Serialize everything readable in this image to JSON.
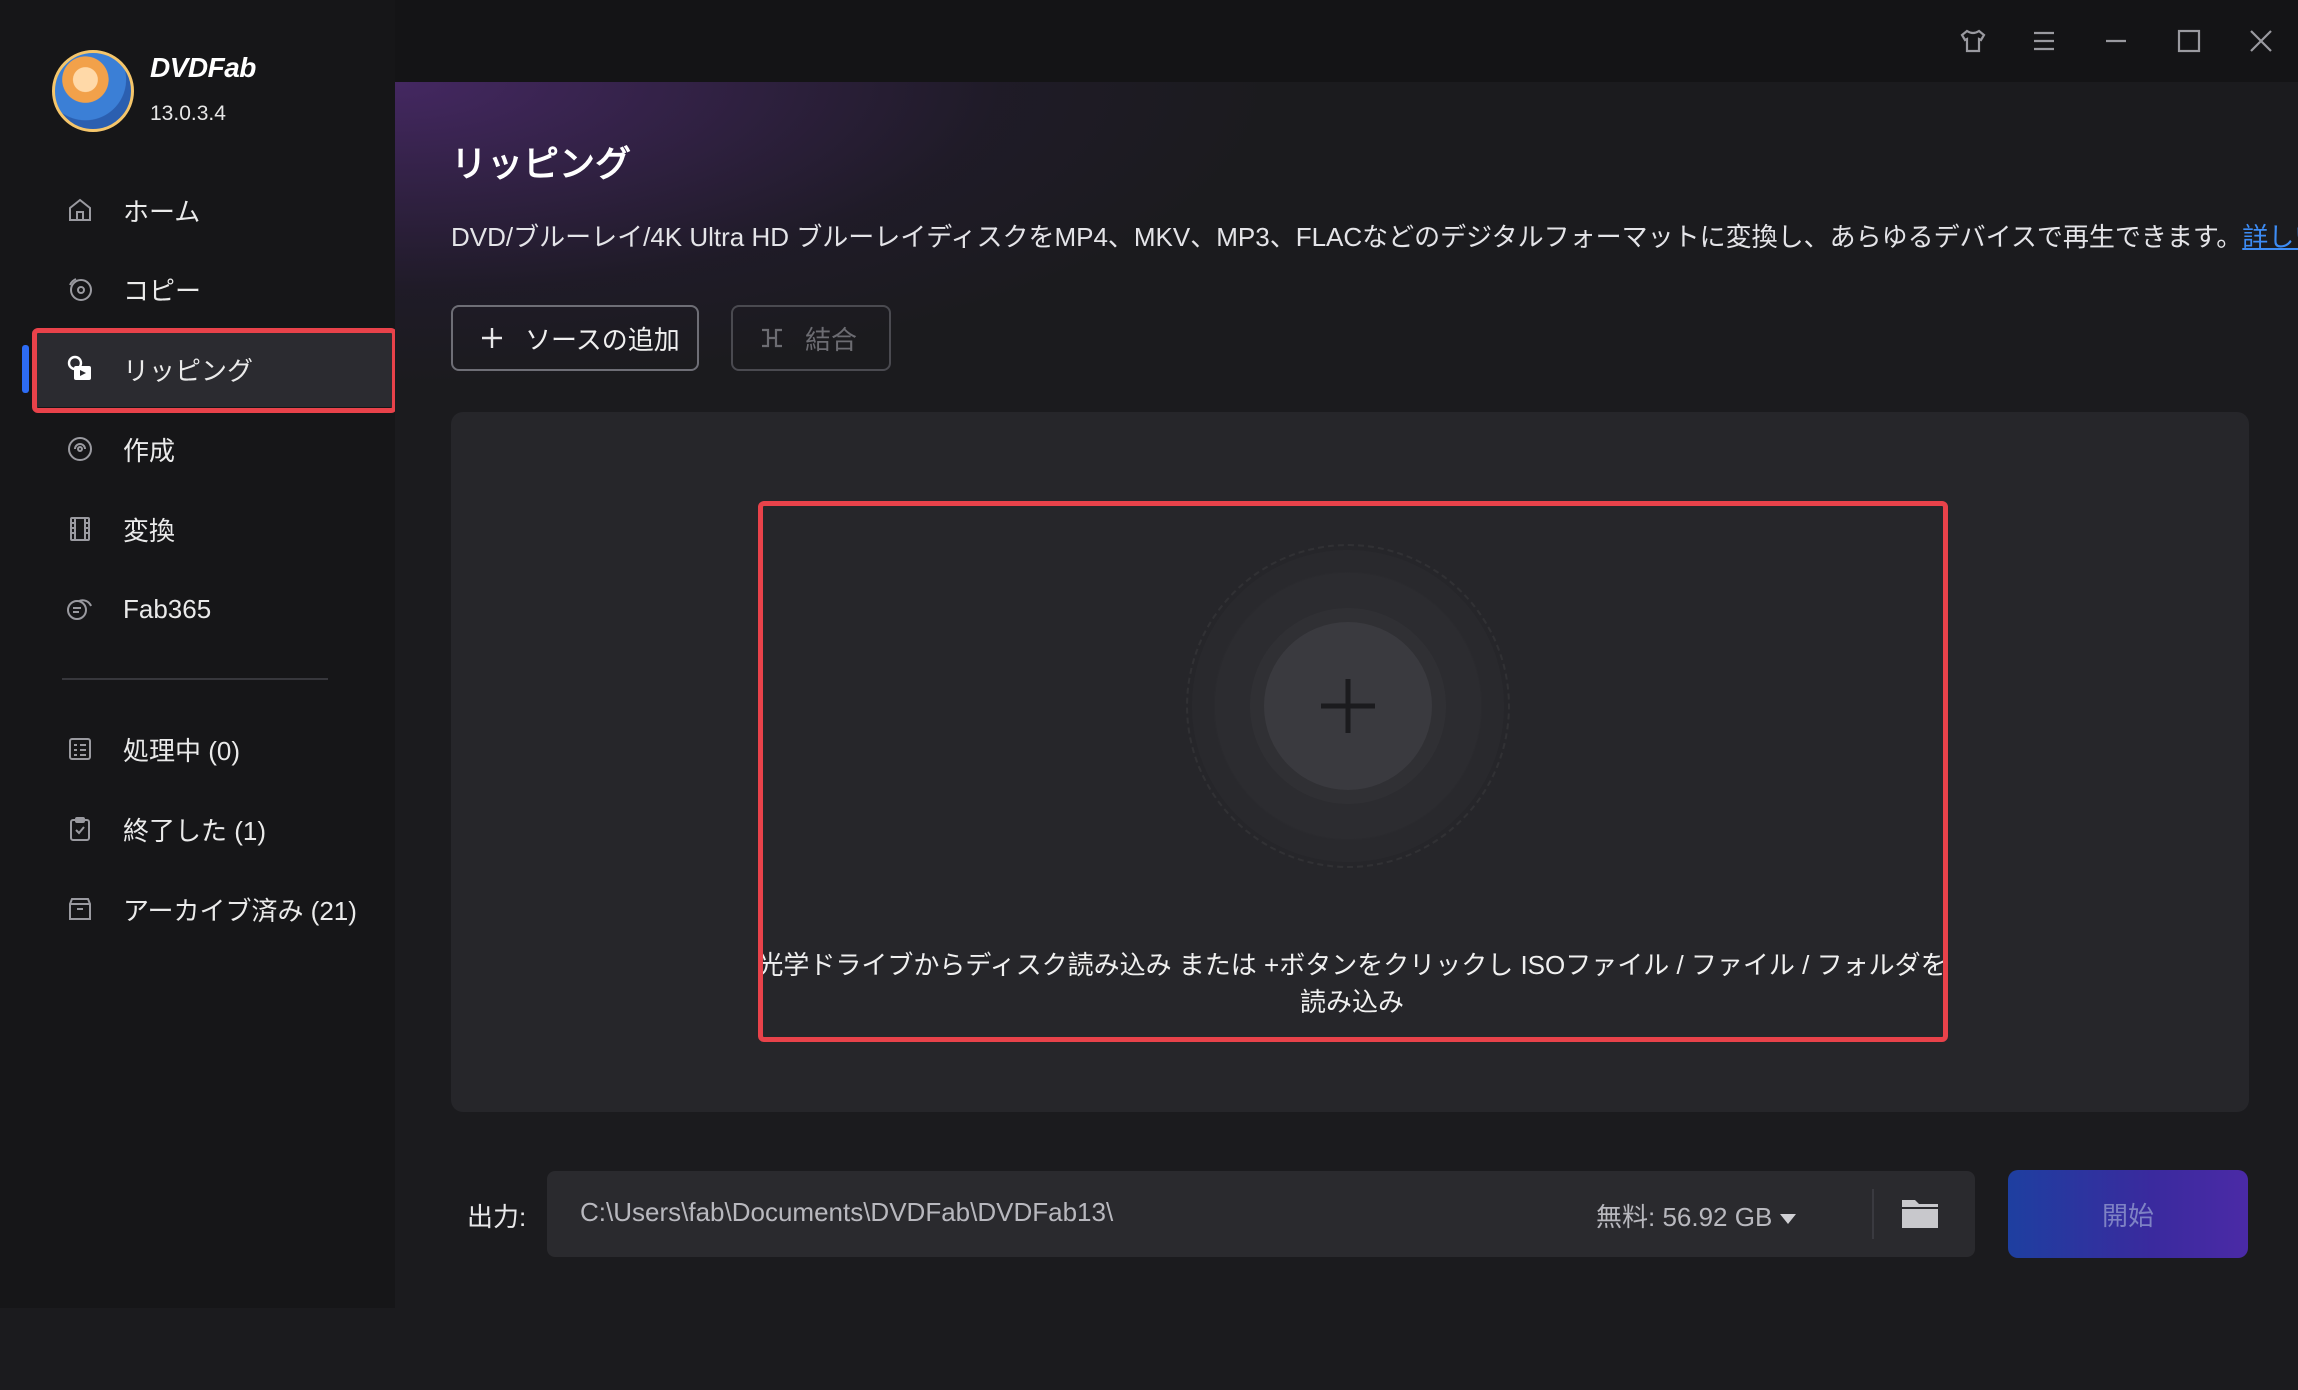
{
  "app": {
    "name": "DVDFab",
    "version": "13.0.3.4"
  },
  "sidebar": {
    "items": [
      {
        "label": "ホーム",
        "icon": "home-icon"
      },
      {
        "label": "コピー",
        "icon": "copy-disc-icon"
      },
      {
        "label": "リッピング",
        "icon": "ripper-icon",
        "active": true
      },
      {
        "label": "作成",
        "icon": "creator-icon"
      },
      {
        "label": "変換",
        "icon": "film-icon"
      },
      {
        "label": "Fab365",
        "icon": "fab365-icon"
      }
    ],
    "queue": [
      {
        "label": "処理中 (0)",
        "icon": "task-list-icon"
      },
      {
        "label": "終了した (1)",
        "icon": "clipboard-check-icon"
      },
      {
        "label": "アーカイブ済み (21)",
        "icon": "archive-icon"
      }
    ]
  },
  "titlebar": {
    "icons": [
      "skin-icon",
      "menu-icon",
      "minimize-icon",
      "maximize-icon",
      "close-icon"
    ]
  },
  "main": {
    "title": "リッピング",
    "description": "DVD/ブルーレイ/4K Ultra HD ブルーレイディスクをMP4、MKV、MP3、FLACなどのデジタルフォーマットに変換し、あらゆるデバイスで再生できます。",
    "more_link": "詳しい情報...",
    "add_source_label": "ソースの追加",
    "merge_label": "結合",
    "drop_hint": "光学ドライブからディスク読み込み または +ボタンをクリックし ISOファイル / ファイル / フォルダを読み込み"
  },
  "output": {
    "label": "出力:",
    "path": "C:\\Users\\fab\\Documents\\DVDFab\\DVDFab13\\",
    "free_space": "無料: 56.92 GB",
    "start_label": "開始"
  },
  "colors": {
    "accent": "#2d6cf5",
    "highlight_box": "#e8424a",
    "link": "#3d8cf5"
  }
}
